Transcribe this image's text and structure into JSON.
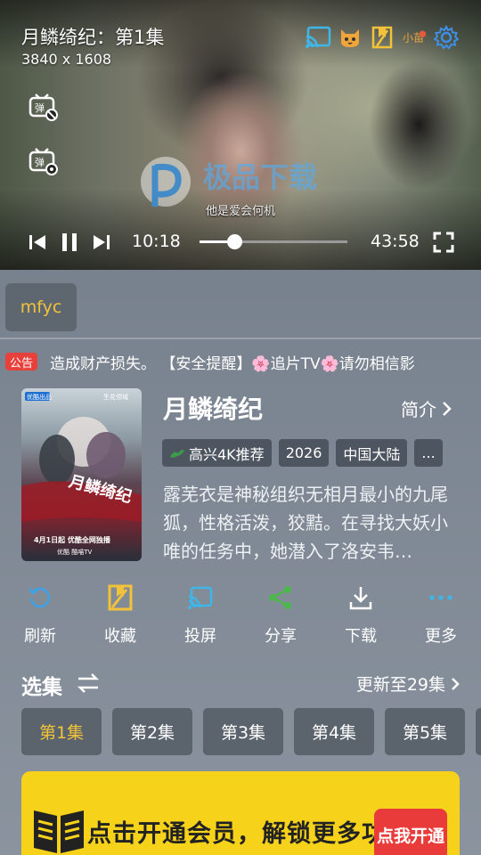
{
  "player": {
    "title": "月鳞绮纪：第1集",
    "resolution": "3840 x 1608",
    "subtitle": "他是爱会何机",
    "watermark_text": "极品下载",
    "current_time": "10:18",
    "total_time": "43:58",
    "progress": 0.234,
    "top_icons": [
      "cast-icon",
      "cat-icon",
      "favorite-box-icon",
      "floating-logo-icon",
      "settings-gear-icon"
    ],
    "danmu_icons": [
      "danmu-off-icon",
      "danmu-settings-icon"
    ]
  },
  "source": {
    "chip_label": "mfyc"
  },
  "notice": {
    "badge": "公告",
    "text": "造成财产损失。        【安全提醒】🌸追片TV🌸请勿相信影"
  },
  "info": {
    "title": "月鳞绮纪",
    "intro_label": "简介",
    "tags": [
      {
        "label": "高兴4K推荐",
        "icon": "dragon-icon"
      },
      {
        "label": "2026"
      },
      {
        "label": "中国大陆"
      },
      {
        "label": "..."
      }
    ],
    "description": "露芜衣是神秘组织无相月最小的九尾狐，性格活泼，狡黠。在寻找大妖小唯的任务中，她潜入了洛安韦…",
    "poster": {
      "top_left": "优酷出品",
      "top_right": "生花领域",
      "title": "月鳞绮纪",
      "date_line": "4月1日起 优酷全网独播",
      "platforms": "优酷  酷喵TV"
    }
  },
  "actions": [
    {
      "label": "刷新",
      "icon": "refresh-icon",
      "color": "#3fa2e6"
    },
    {
      "label": "收藏",
      "icon": "bookmark-icon",
      "color": "#f2c33a"
    },
    {
      "label": "投屏",
      "icon": "cast-icon",
      "color": "#3fb6e8"
    },
    {
      "label": "分享",
      "icon": "share-icon",
      "color": "#4cb84c"
    },
    {
      "label": "下载",
      "icon": "download-icon",
      "color": "#ffffff"
    },
    {
      "label": "更多",
      "icon": "more-dots-icon",
      "color": "#3fb6e8"
    }
  ],
  "episodes": {
    "title": "选集",
    "update_text": "更新至29集",
    "items": [
      "第1集",
      "第2集",
      "第3集",
      "第4集",
      "第5集"
    ],
    "active_index": 0
  },
  "banner": {
    "text": "点击开通会员，解锁更多功能",
    "button": "点我开通",
    "bg_color": "#f6d21b"
  }
}
